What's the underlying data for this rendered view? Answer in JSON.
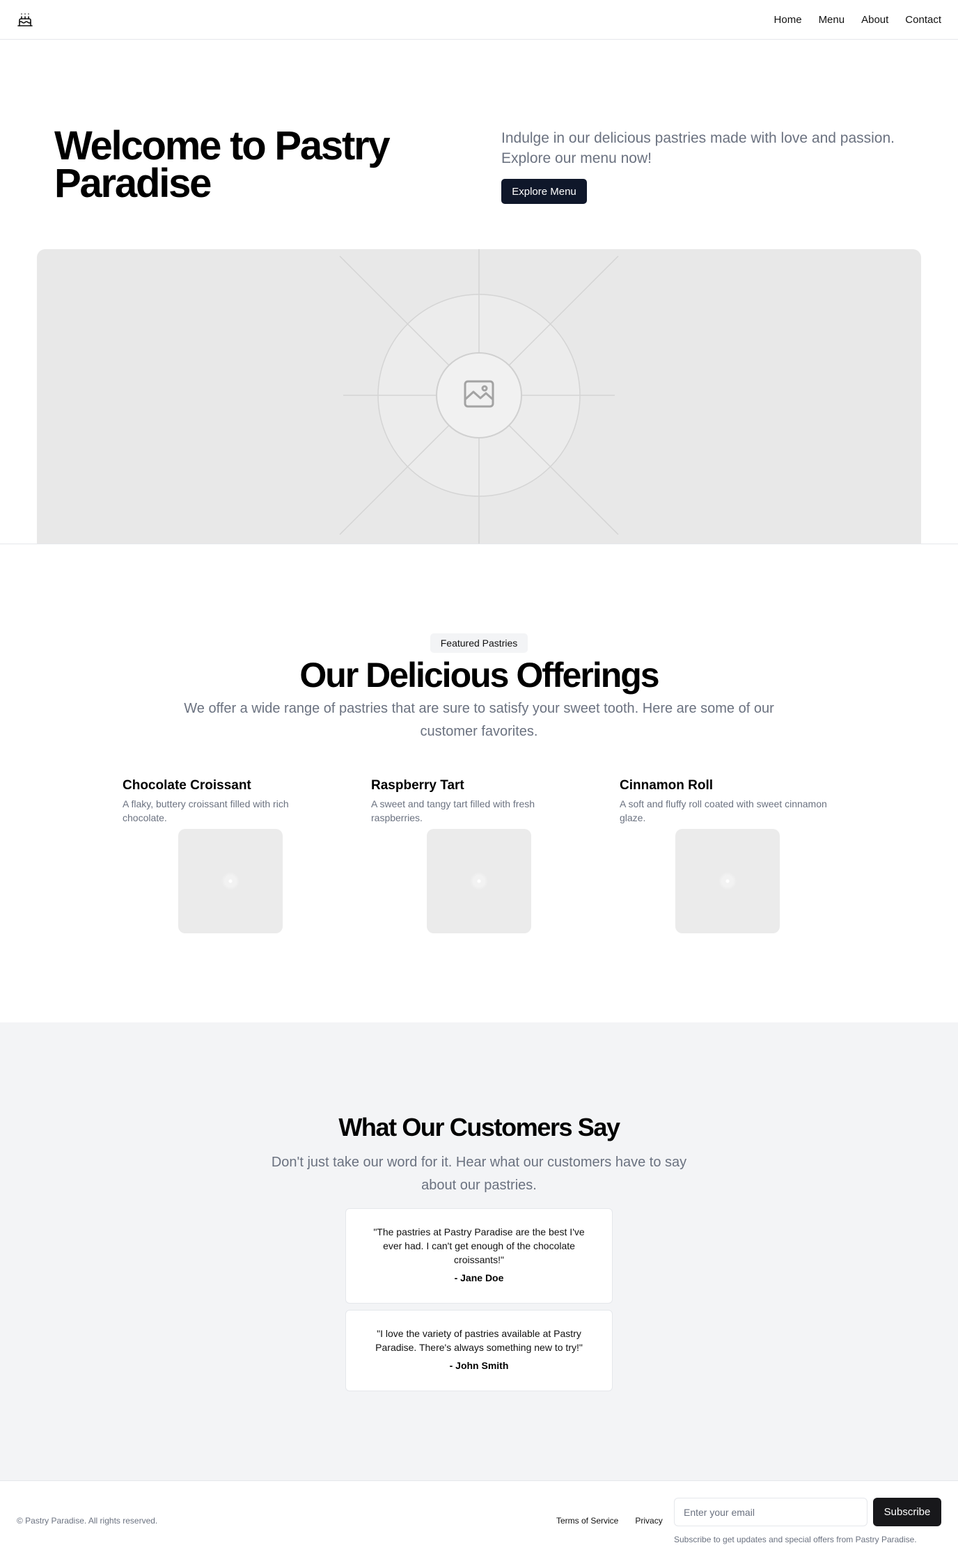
{
  "nav": {
    "logo_icon": "cake-icon",
    "links": [
      "Home",
      "Menu",
      "About",
      "Contact"
    ]
  },
  "hero": {
    "title": "Welcome to Pastry Paradise",
    "subtitle": "Indulge in our delicious pastries made with love and passion. Explore our menu now!",
    "button": "Explore Menu",
    "image_icon": "image-placeholder-icon"
  },
  "offerings": {
    "badge": "Featured Pastries",
    "title": "Our Delicious Offerings",
    "subtitle": "We offer a wide range of pastries that are sure to satisfy your sweet tooth. Here are some of our customer favorites.",
    "items": [
      {
        "name": "Chocolate Croissant",
        "description": "A flaky, buttery croissant filled with rich chocolate."
      },
      {
        "name": "Raspberry Tart",
        "description": "A sweet and tangy tart filled with fresh raspberries."
      },
      {
        "name": "Cinnamon Roll",
        "description": "A soft and fluffy roll coated with sweet cinnamon glaze."
      }
    ]
  },
  "testimonials": {
    "title": "What Our Customers Say",
    "subtitle": "Don't just take our word for it. Hear what our customers have to say about our pastries.",
    "items": [
      {
        "quote": "\"The pastries at Pastry Paradise are the best I've ever had. I can't get enough of the chocolate croissants!\"",
        "author": "- Jane Doe"
      },
      {
        "quote": "\"I love the variety of pastries available at Pastry Paradise. There's always something new to try!\"",
        "author": "- John Smith"
      }
    ]
  },
  "footer": {
    "copyright": "© Pastry Paradise. All rights reserved.",
    "links": [
      "Terms of Service",
      "Privacy"
    ],
    "email_placeholder": "Enter your email",
    "subscribe_button": "Subscribe",
    "note": "Subscribe to get updates and special offers from Pastry Paradise."
  },
  "colors": {
    "primary_button": "#0f172a",
    "subscribe_button": "#18181b",
    "muted_text": "#6b7280",
    "section_bg": "#f3f4f6"
  }
}
